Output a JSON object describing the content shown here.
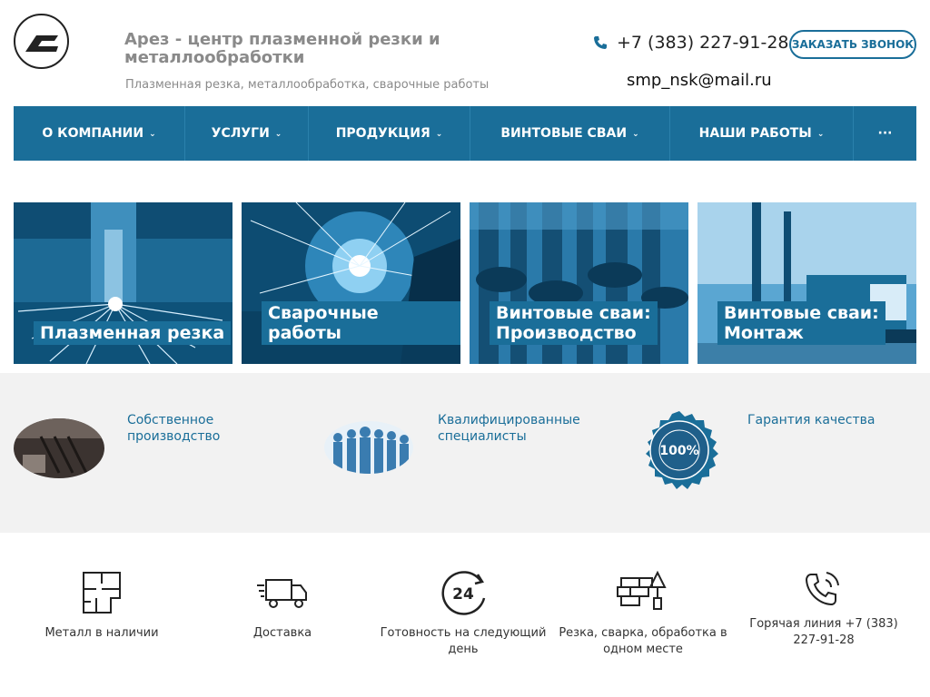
{
  "header": {
    "title": "Арез - центр плазменной резки и металлообработки",
    "subtitle": "Плазменная резка, металлообработка, сварочные работы",
    "phone": "+7 (383) 227-91-28",
    "email": "smp_nsk@mail.ru",
    "callback_label": "ЗАКАЗАТЬ ЗВОНОК"
  },
  "nav": {
    "items": [
      {
        "label": "О КОМПАНИИ"
      },
      {
        "label": "УСЛУГИ"
      },
      {
        "label": "ПРОДУКЦИЯ"
      },
      {
        "label": "ВИНТОВЫЕ СВАИ"
      },
      {
        "label": "НАШИ РАБОТЫ"
      },
      {
        "label": "···"
      }
    ]
  },
  "tiles": [
    {
      "label": "Плазменная резка"
    },
    {
      "label": "Сварочные работы"
    },
    {
      "label": "Винтовые сваи:\nПроизводство"
    },
    {
      "label": "Винтовые сваи:\nМонтаж"
    }
  ],
  "features": [
    {
      "label": "Собственное производство"
    },
    {
      "label": "Квалифицированные специалисты"
    },
    {
      "label": "Гарантия качества"
    }
  ],
  "badge": {
    "percent": "100%",
    "ring_text": "Гарантия качества"
  },
  "benefits": [
    {
      "label": "Металл в наличии",
      "icon": "floorplan-icon"
    },
    {
      "label": "Доставка",
      "icon": "truck-icon"
    },
    {
      "label": "Готовность на следующий день",
      "icon": "24h-icon"
    },
    {
      "label": "Резка, сварка, обработка в одном месте",
      "icon": "bricks-trowel-icon"
    },
    {
      "label": "Горячая линия +7 (383) 227-91-28",
      "icon": "phone-icon"
    }
  ],
  "colors": {
    "brand": "#1a6e99",
    "features_bg": "#f2f2f2"
  }
}
